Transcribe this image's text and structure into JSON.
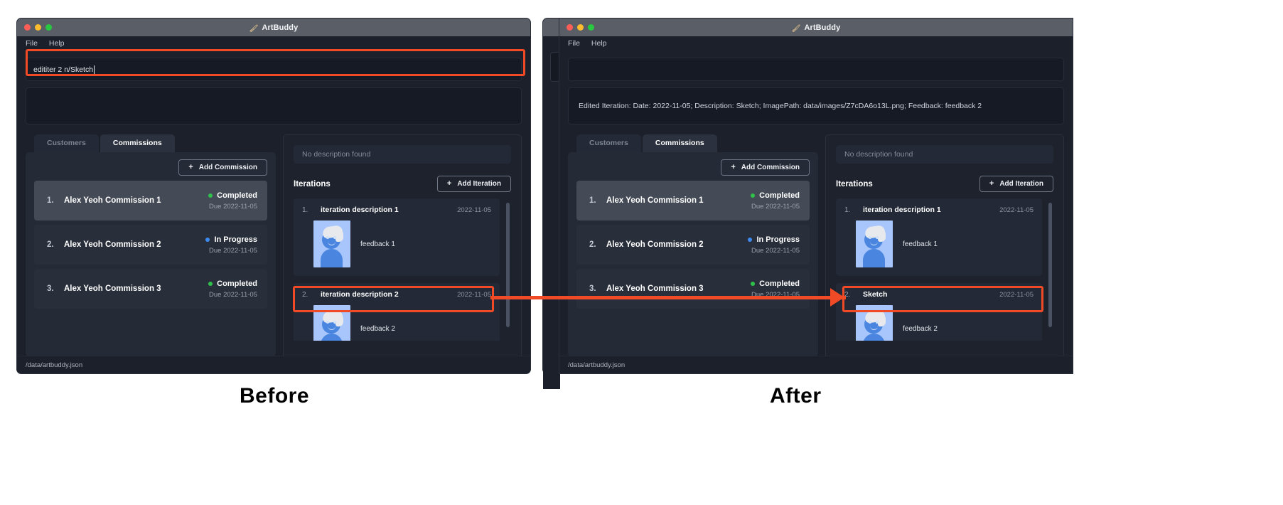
{
  "app": {
    "title": "ArtBuddy",
    "title_icon": "paintbrush-icon",
    "menu": [
      "File",
      "Help"
    ],
    "status_path": "/data/artbuddy.json"
  },
  "before": {
    "input_value": "edititer 2 n/Sketch",
    "log_message": "",
    "tabs": [
      {
        "label": "Customers",
        "active": false
      },
      {
        "label": "Commissions",
        "active": true
      }
    ],
    "add_commission_label": "Add Commission",
    "commissions": [
      {
        "index": "1.",
        "name": "Alex Yeoh Commission 1",
        "status": "Completed",
        "status_color": "#2fc14a",
        "due": "Due 2022-11-05",
        "selected": true
      },
      {
        "index": "2.",
        "name": "Alex Yeoh Commission 2",
        "status": "In Progress",
        "status_color": "#3e8bf0",
        "due": "Due 2022-11-05",
        "selected": false
      },
      {
        "index": "3.",
        "name": "Alex Yeoh Commission 3",
        "status": "Completed",
        "status_color": "#2fc14a",
        "due": "Due 2022-11-05",
        "selected": false
      }
    ],
    "description_placeholder": "No description found",
    "iterations_heading": "Iterations",
    "add_iteration_label": "Add Iteration",
    "iterations": [
      {
        "index": "1.",
        "description": "iteration description 1",
        "date": "2022-11-05",
        "feedback": "feedback 1"
      },
      {
        "index": "2.",
        "description": "iteration description 2",
        "date": "2022-11-05",
        "feedback": "feedback 2"
      }
    ]
  },
  "after": {
    "input_value": "",
    "log_message": "Edited Iteration: Date: 2022-11-05; Description: Sketch; ImagePath: data/images/Z7cDA6o13L.png; Feedback: feedback 2",
    "tabs": [
      {
        "label": "Customers",
        "active": false
      },
      {
        "label": "Commissions",
        "active": true
      }
    ],
    "add_commission_label": "Add Commission",
    "commissions": [
      {
        "index": "1.",
        "name": "Alex Yeoh Commission 1",
        "status": "Completed",
        "status_color": "#2fc14a",
        "due": "Due 2022-11-05",
        "selected": true
      },
      {
        "index": "2.",
        "name": "Alex Yeoh Commission 2",
        "status": "In Progress",
        "status_color": "#3e8bf0",
        "due": "Due 2022-11-05",
        "selected": false
      },
      {
        "index": "3.",
        "name": "Alex Yeoh Commission 3",
        "status": "Completed",
        "status_color": "#2fc14a",
        "due": "Due 2022-11-05",
        "selected": false
      }
    ],
    "description_placeholder": "No description found",
    "iterations_heading": "Iterations",
    "add_iteration_label": "Add Iteration",
    "iterations": [
      {
        "index": "1.",
        "description": "iteration description 1",
        "date": "2022-11-05",
        "feedback": "feedback 1"
      },
      {
        "index": "2.",
        "description": "Sketch",
        "date": "2022-11-05",
        "feedback": "feedback 2"
      }
    ]
  },
  "captions": {
    "before": "Before",
    "after": "After"
  },
  "annotation": {
    "highlight_color": "#f04a26"
  }
}
